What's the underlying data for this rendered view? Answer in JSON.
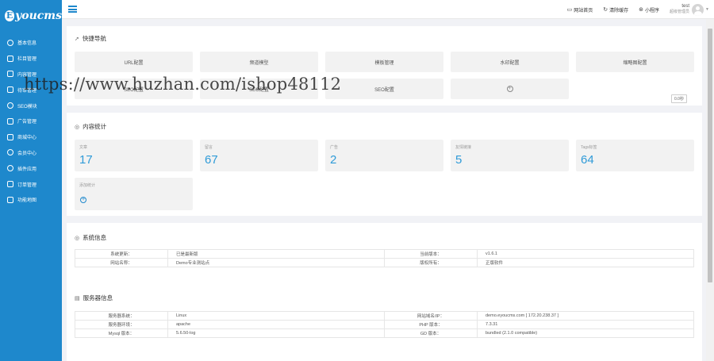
{
  "brand": {
    "logo_letter": "E",
    "logo_text": "youcms"
  },
  "sidebar": {
    "items": [
      {
        "label": "基本信息",
        "icon": "gear-icon"
      },
      {
        "label": "栏目管理",
        "icon": "layers-icon"
      },
      {
        "label": "内容管理",
        "icon": "document-icon"
      },
      {
        "label": "待审管理",
        "icon": "list-icon"
      },
      {
        "label": "SEO模块",
        "icon": "globe-icon"
      },
      {
        "label": "广告管理",
        "icon": "image-icon"
      },
      {
        "label": "商城中心",
        "icon": "cart-icon"
      },
      {
        "label": "会员中心",
        "icon": "user-icon"
      },
      {
        "label": "插件应用",
        "icon": "plugin-icon"
      },
      {
        "label": "订单管理",
        "icon": "order-icon"
      },
      {
        "label": "功能地图",
        "icon": "grid-icon"
      }
    ]
  },
  "topbar": {
    "links": [
      {
        "label": "网站首页",
        "icon": "monitor-icon"
      },
      {
        "label": "清除缓存",
        "icon": "refresh-icon"
      },
      {
        "label": "小程序",
        "icon": "miniapp-icon"
      }
    ],
    "user": {
      "name": "test",
      "role": "超级管理员"
    }
  },
  "quick_nav": {
    "title": "快捷导航",
    "tiles": [
      "URL配置",
      "频道模型",
      "模板管理",
      "水印配置",
      "缩略图配置",
      "SEO配置",
      "SEO配置",
      "SEO配置"
    ],
    "badge": "0.0秒"
  },
  "content_stats": {
    "title": "内容统计",
    "items": [
      {
        "label": "文章",
        "value": "17"
      },
      {
        "label": "留言",
        "value": "67"
      },
      {
        "label": "广告",
        "value": "2"
      },
      {
        "label": "友情链接",
        "value": "5"
      },
      {
        "label": "Tags标签",
        "value": "64"
      }
    ],
    "add_label": "添加统计"
  },
  "system_info": {
    "title": "系统信息",
    "rows": [
      [
        "系统更新：",
        "已是最新版",
        "当前版本：",
        "v1.6.1"
      ],
      [
        "网站名称：",
        "Demo专业测站点",
        "版权所有：",
        "正版软件"
      ]
    ]
  },
  "server_info": {
    "title": "服务器信息",
    "rows": [
      [
        "服务器系统：",
        "Linux",
        "网站域名/IP：",
        "demo.eyoucms.com [ 172.20.238.37 ]"
      ],
      [
        "服务器环境：",
        "apache",
        "PHP 版本：",
        "7.3.31"
      ],
      [
        "Mysql 版本：",
        "5.6.50-log",
        "GD 版本：",
        "bundled (2.1.0 compatible)"
      ]
    ]
  },
  "watermark": "https://www.huzhan.com/ishop48112",
  "colors": {
    "sidebar": "#1e88cc",
    "accent_number": "#2f9bd8",
    "page_bg": "#f1f2f6"
  }
}
